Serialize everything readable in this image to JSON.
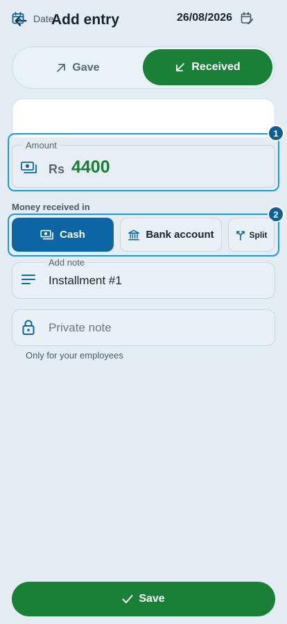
{
  "header": {
    "title": "Add entry",
    "back_icon": "arrow-left-icon"
  },
  "toggle": {
    "gave_label": "Gave",
    "received_label": "Received",
    "selected": "Received"
  },
  "date": {
    "label": "Date",
    "value": "26/08/2026"
  },
  "amount": {
    "label": "Amount",
    "currency": "Rs",
    "value": "4400"
  },
  "badges": {
    "amount": "1",
    "payment": "2"
  },
  "payment": {
    "section_label": "Money received in",
    "options": [
      {
        "label": "Cash",
        "selected": true
      },
      {
        "label": "Bank account",
        "selected": false
      },
      {
        "label": "Split",
        "selected": false
      }
    ]
  },
  "note": {
    "label": "Add note",
    "value": "Installment #1"
  },
  "private_note": {
    "placeholder": "Private note",
    "hint": "Only for your employees"
  },
  "save": {
    "label": "Save"
  },
  "colors": {
    "primary_green": "#1b8037",
    "primary_blue": "#0e65a3",
    "highlight": "#1a9ad6",
    "background": "#e4edf3"
  }
}
